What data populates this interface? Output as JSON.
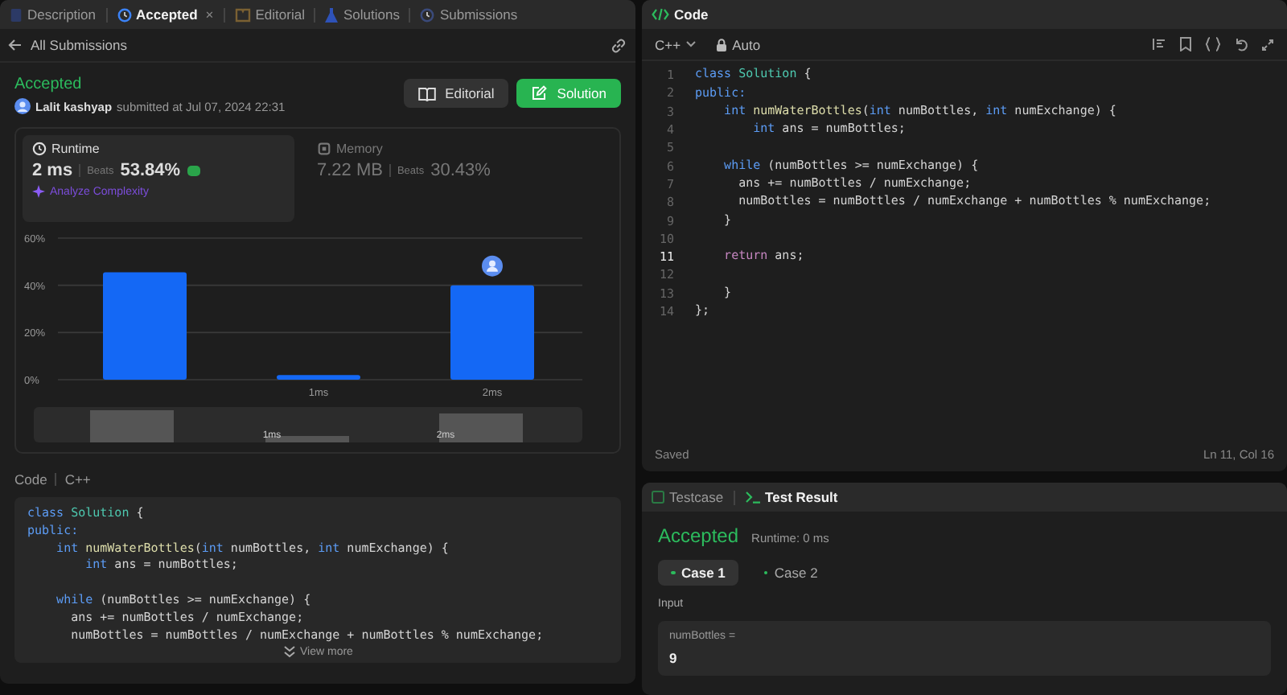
{
  "left_tabs": [
    {
      "label": "Description",
      "selected": false
    },
    {
      "label": "Accepted",
      "selected": true,
      "close": "×"
    },
    {
      "label": "Editorial",
      "selected": false
    },
    {
      "label": "Solutions",
      "selected": false
    },
    {
      "label": "Submissions",
      "selected": false
    }
  ],
  "back_link": "All Submissions",
  "submission": {
    "status": "Accepted",
    "user": "Lalit kashyap",
    "submitted": "submitted at Jul 07, 2024 22:31",
    "buttons": [
      {
        "label": "Editorial",
        "kind": "secondary"
      },
      {
        "label": "Solution",
        "kind": "primary"
      }
    ]
  },
  "stats": [
    {
      "label": "Runtime",
      "value": "2 ms",
      "beats_label": "Beats",
      "beats": "53.84%",
      "selected": true,
      "analyze": "Analyze Complexity"
    },
    {
      "label": "Memory",
      "value": "7.22 MB",
      "beats_label": "Beats",
      "beats": "30.43%",
      "selected": false
    }
  ],
  "chart_data": {
    "type": "bar",
    "categories": [
      null,
      "1ms",
      "2ms"
    ],
    "values": [
      45.5,
      2,
      40
    ],
    "ylim": [
      0,
      60
    ],
    "yticks": [
      {
        "value": 0,
        "label": "0%"
      },
      {
        "value": 20,
        "label": "20%"
      },
      {
        "value": 40,
        "label": "40%"
      },
      {
        "value": 60,
        "label": "60%"
      }
    ]
  },
  "overview_labels": [
    "1ms",
    "2ms"
  ],
  "code_preview": {
    "label": "Code",
    "language": "C++",
    "more": "View more",
    "lines": [
      {
        "kind": "code",
        "tokens": [
          {
            "text": "class",
            "kind": "keyword"
          },
          {
            "text": " Solution",
            "kind": "class"
          },
          {
            "text": " {",
            "kind": "plain"
          }
        ]
      },
      {
        "kind": "code",
        "tokens": [
          {
            "text": "public:",
            "kind": "keyword"
          }
        ]
      },
      {
        "kind": "code",
        "tokens": [
          {
            "text": "    int",
            "kind": "keyword"
          },
          {
            "text": " numWaterBottles",
            "kind": "function"
          },
          {
            "text": "(",
            "kind": "plain"
          },
          {
            "text": "int",
            "kind": "keyword"
          },
          {
            "text": " numBottles, ",
            "kind": "plain"
          },
          {
            "text": "int",
            "kind": "keyword"
          },
          {
            "text": " numExchange) {",
            "kind": "plain"
          }
        ]
      },
      {
        "kind": "code",
        "tokens": [
          {
            "text": "        int",
            "kind": "keyword"
          },
          {
            "text": " ans = numBottles;",
            "kind": "plain"
          }
        ]
      },
      {
        "kind": "blank"
      },
      {
        "kind": "code",
        "tokens": [
          {
            "text": "    while",
            "kind": "keyword"
          },
          {
            "text": " (numBottles >= numExchange) {",
            "kind": "plain"
          }
        ]
      },
      {
        "kind": "code",
        "tokens": [
          {
            "text": "      ans += numBottles / numExchange;",
            "kind": "plain"
          }
        ]
      },
      {
        "kind": "code",
        "tokens": [
          {
            "text": "      numBottles = numBottles / numExchange + numBottles % numExchange;",
            "kind": "plain"
          }
        ]
      }
    ]
  },
  "editor": {
    "title": "Code",
    "language": "C++",
    "mode": "Auto",
    "status": "Saved",
    "cursor": "Ln 11, Col 16",
    "lines": [
      {
        "n": "1",
        "current": false,
        "tokens": [
          {
            "text": "class",
            "kind": "keyword"
          },
          {
            "text": " Solution",
            "kind": "class"
          },
          {
            "text": " {",
            "kind": "plain"
          }
        ]
      },
      {
        "n": "2",
        "current": false,
        "tokens": [
          {
            "text": "public:",
            "kind": "keyword"
          }
        ]
      },
      {
        "n": "3",
        "current": false,
        "tokens": [
          {
            "text": "    int",
            "kind": "keyword"
          },
          {
            "text": " numWaterBottles",
            "kind": "function"
          },
          {
            "text": "(",
            "kind": "plain"
          },
          {
            "text": "int",
            "kind": "keyword"
          },
          {
            "text": " numBottles, ",
            "kind": "plain"
          },
          {
            "text": "int",
            "kind": "keyword"
          },
          {
            "text": " numExchange) {",
            "kind": "plain"
          }
        ]
      },
      {
        "n": "4",
        "current": false,
        "tokens": [
          {
            "text": "        int",
            "kind": "keyword"
          },
          {
            "text": " ans = numBottles;",
            "kind": "plain"
          }
        ]
      },
      {
        "n": "5",
        "current": false
      },
      {
        "n": "6",
        "current": false,
        "tokens": [
          {
            "text": "    while",
            "kind": "keyword"
          },
          {
            "text": " (numBottles >= numExchange) {",
            "kind": "plain"
          }
        ]
      },
      {
        "n": "7",
        "current": false,
        "tokens": [
          {
            "text": "      ans += numBottles / numExchange;",
            "kind": "plain"
          }
        ]
      },
      {
        "n": "8",
        "current": false,
        "tokens": [
          {
            "text": "      numBottles = numBottles / numExchange + numBottles % numExchange;",
            "kind": "plain"
          }
        ]
      },
      {
        "n": "9",
        "current": false,
        "tokens": [
          {
            "text": "    }",
            "kind": "plain"
          }
        ]
      },
      {
        "n": "10",
        "current": false
      },
      {
        "n": "11",
        "current": true,
        "tokens": [
          {
            "text": "    return",
            "kind": "control"
          },
          {
            "text": " ans;",
            "kind": "plain"
          }
        ]
      },
      {
        "n": "12",
        "current": false
      },
      {
        "n": "13",
        "current": false,
        "tokens": [
          {
            "text": "    }",
            "kind": "plain"
          }
        ]
      },
      {
        "n": "14",
        "current": false,
        "tokens": [
          {
            "text": "};",
            "kind": "plain"
          }
        ]
      }
    ]
  },
  "test_tabs": [
    {
      "label": "Testcase",
      "selected": false
    },
    {
      "label": "Test Result",
      "selected": true
    }
  ],
  "result": {
    "status": "Accepted",
    "runtime": "Runtime: 0 ms",
    "cases": [
      {
        "label": "Case 1",
        "selected": true,
        "passed": true
      },
      {
        "label": "Case 2",
        "selected": false,
        "passed": true
      }
    ],
    "input_label": "Input",
    "field_label": "numBottles =",
    "field_value": "9"
  }
}
